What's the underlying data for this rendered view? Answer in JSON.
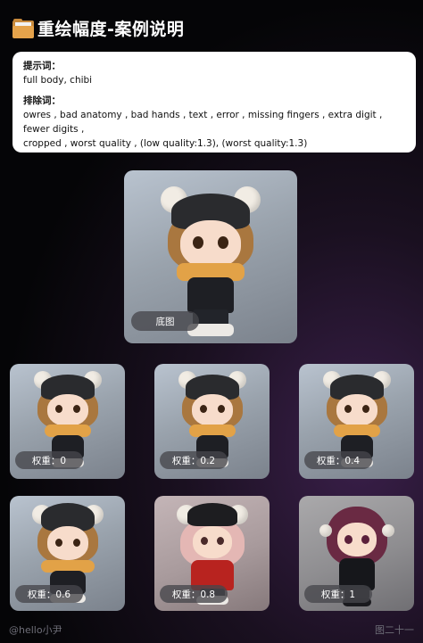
{
  "header": {
    "icon": "card-file-box-icon",
    "title": "重绘幅度-案例说明"
  },
  "prompt": {
    "positive_label": "提示词：",
    "positive_text": "full body, chibi",
    "negative_label": "排除词：",
    "negative_line1": "owres , bad anatomy , bad hands , text , error , missing fingers , extra digit , fewer digits ,",
    "negative_line2": "cropped , worst quality ,  (low quality:1.3), (worst quality:1.3)"
  },
  "base_image": {
    "label": "底图"
  },
  "results": [
    {
      "label": "权重：0"
    },
    {
      "label": "权重：0.2"
    },
    {
      "label": "权重：0.4"
    },
    {
      "label": "权重：0.6"
    },
    {
      "label": "权重：0.8"
    },
    {
      "label": "权重：1"
    }
  ],
  "footer": {
    "author": "@hello小尹",
    "page": "图二十一"
  }
}
